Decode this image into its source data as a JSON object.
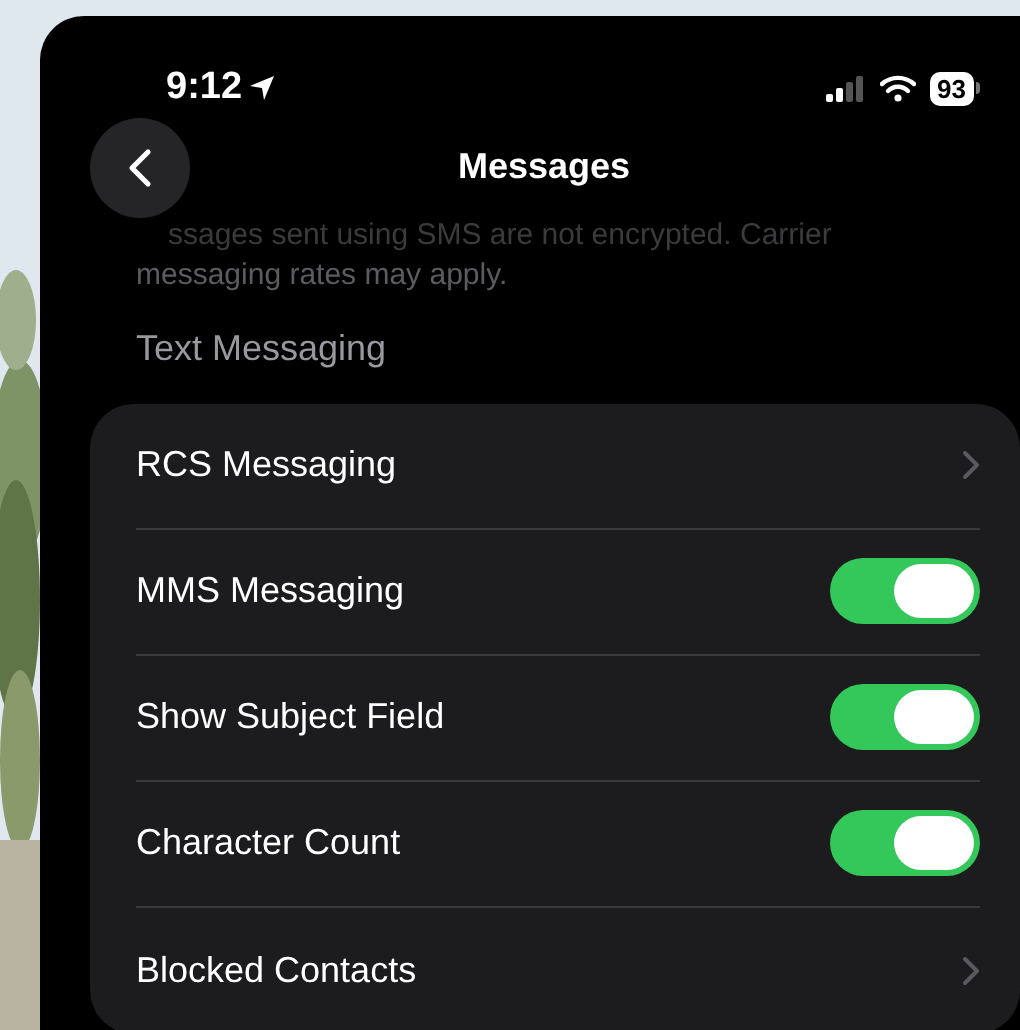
{
  "status_bar": {
    "time": "9:12",
    "battery": "93"
  },
  "nav": {
    "title": "Messages"
  },
  "footnote": {
    "partial_line": "ssages sent using SMS are not encrypted. Carrier",
    "last_line": "messaging rates may apply."
  },
  "section": {
    "header": "Text Messaging"
  },
  "rows": [
    {
      "label": "RCS Messaging",
      "kind": "link"
    },
    {
      "label": "MMS Messaging",
      "kind": "toggle",
      "on": true
    },
    {
      "label": "Show Subject Field",
      "kind": "toggle",
      "on": true
    },
    {
      "label": "Character Count",
      "kind": "toggle",
      "on": true
    },
    {
      "label": "Blocked Contacts",
      "kind": "link"
    }
  ]
}
